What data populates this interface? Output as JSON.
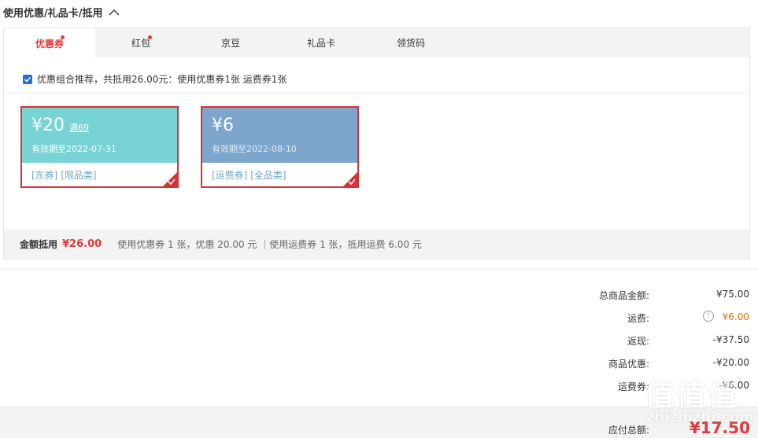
{
  "section": {
    "title": "使用优惠/礼品卡/抵用"
  },
  "tabs": [
    {
      "label": "优惠券",
      "active": true,
      "dot": true
    },
    {
      "label": "红包",
      "active": false,
      "dot": true
    },
    {
      "label": "京豆",
      "active": false,
      "dot": false
    },
    {
      "label": "礼品卡",
      "active": false,
      "dot": false
    },
    {
      "label": "领货码",
      "active": false,
      "dot": false
    }
  ],
  "recommend": {
    "checked": true,
    "text": "优惠组合推荐，共抵用26.00元：使用优惠券1张 运费券1张"
  },
  "coupons": [
    {
      "amount": "¥20",
      "limit": "满69",
      "valid": "有效期至2022-07-31",
      "tag1": "[东券]",
      "tag2": "[限品类]",
      "color": "#78d3d5",
      "valid_color": "#ffffff"
    },
    {
      "amount": "¥6",
      "limit": "",
      "valid": "有效期至2022-08-10",
      "tag1": "[运费券]",
      "tag2": "[全品类]",
      "color": "#7ea6cc",
      "valid_color": "#dde8f3"
    }
  ],
  "summary": {
    "label": "金额抵用",
    "amount": "¥26.00",
    "desc": "使用优惠券 1 张，优惠 20.00 元 ｜使用运费券 1 张，抵用运费 6.00 元"
  },
  "totals": {
    "goods_label": "总商品金额:",
    "goods_value": "¥75.00",
    "shipping_label": "运费:",
    "shipping_value": "¥6.00",
    "shipping_info_icon": "info-icon",
    "cashback_label": "返现:",
    "cashback_value": "-¥37.50",
    "discount_label": "商品优惠:",
    "discount_value": "-¥20.00",
    "shipcoupon_label": "运费券:",
    "shipcoupon_value": "-¥6.00"
  },
  "footer": {
    "payable_label": "应付总额:",
    "payable_value": "¥17.50"
  },
  "watermark": {
    "top": "值值值",
    "bottom": "zhizhizhi.com"
  },
  "colors": {
    "accent": "#e4393c",
    "orange": "#f06a00"
  }
}
